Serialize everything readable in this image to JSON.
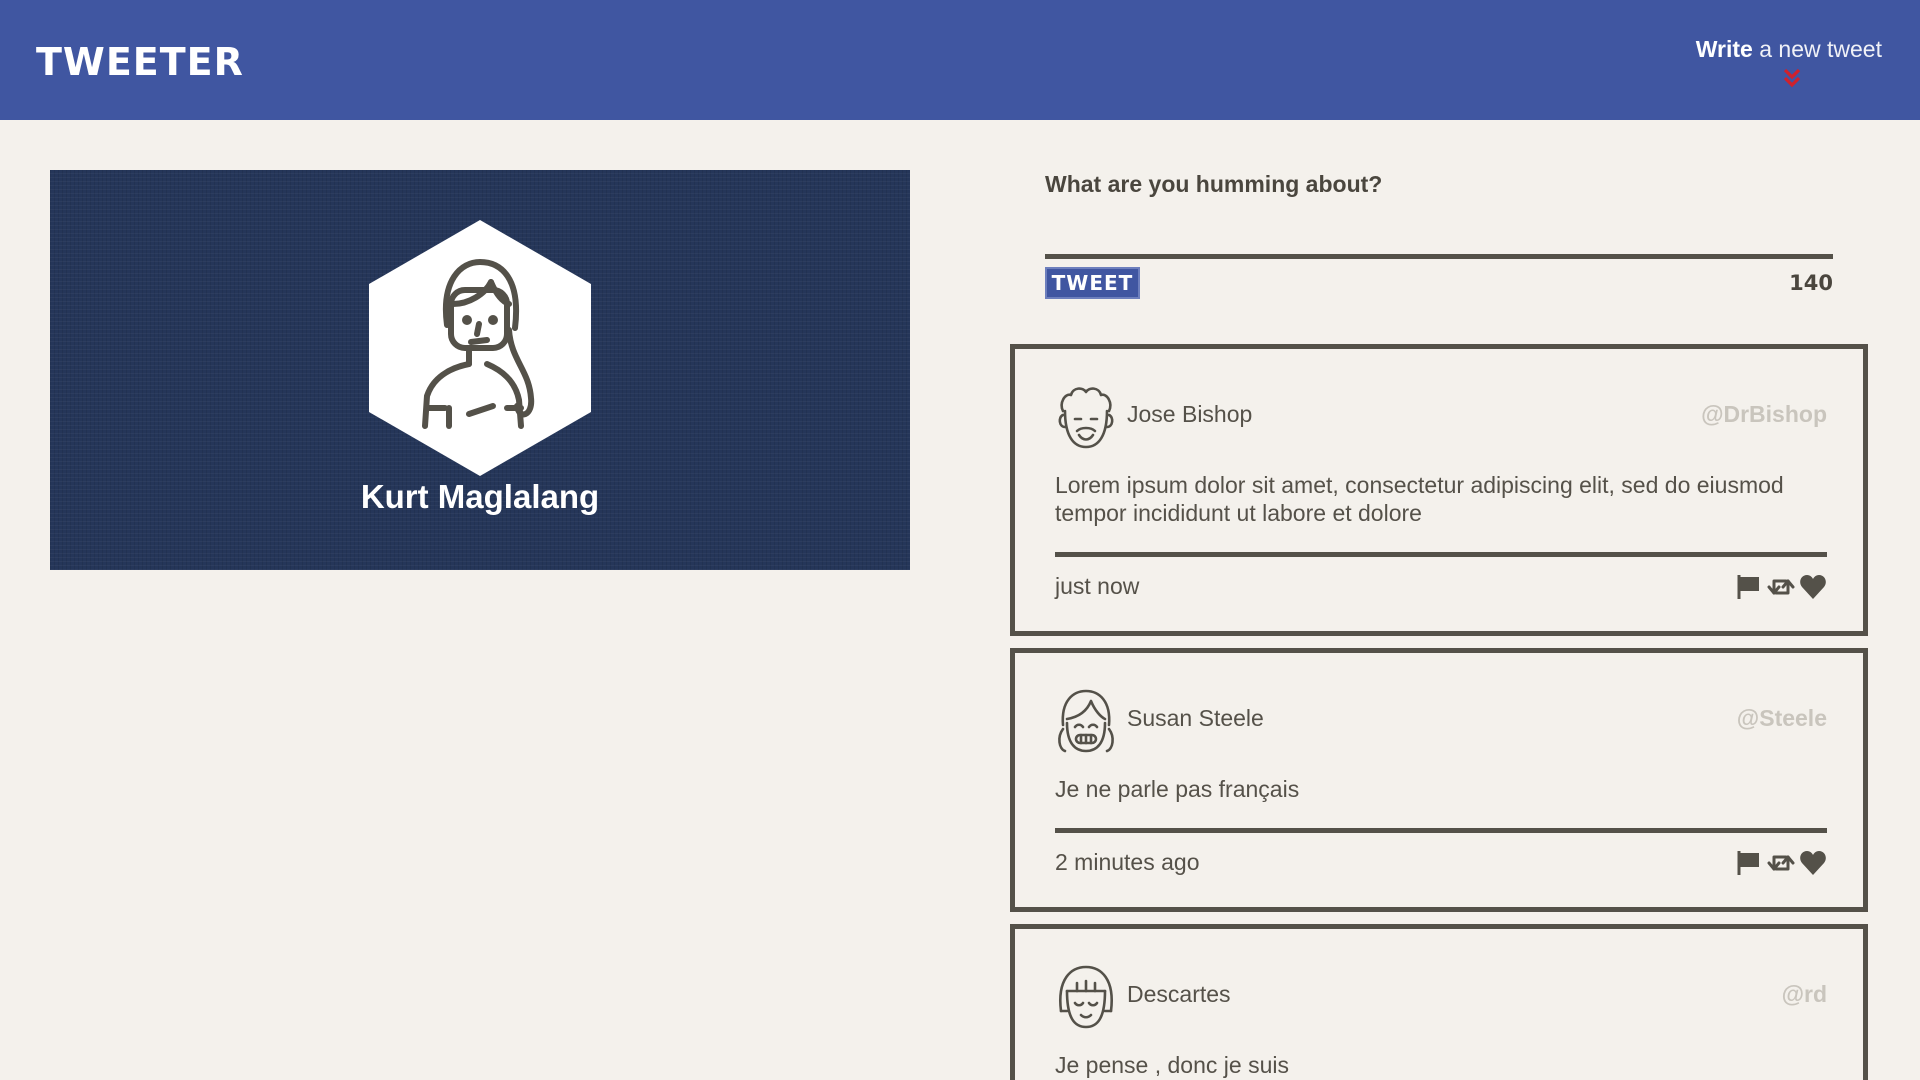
{
  "header": {
    "brand": "TWEETER",
    "compose_toggle": {
      "strong": "Write",
      "rest": " a new tweet"
    },
    "icon": "double-chevron-down-icon"
  },
  "profile": {
    "name": "Kurt Maglalang",
    "avatar_icon": "woman-avatar-icon"
  },
  "compose": {
    "prompt": "What are you humming about?",
    "input_value": "",
    "button_label": "TWEET",
    "char_count": "140"
  },
  "tweets": [
    {
      "name": "Jose Bishop",
      "handle": "@DrBishop",
      "text": "Lorem ipsum dolor sit amet, consectetur adipiscing elit, sed do eiusmod tempor incididunt ut labore et dolore",
      "time": "just now",
      "avatar_icon": "curly-hair-man-avatar-icon"
    },
    {
      "name": "Susan Steele",
      "handle": "@Steele",
      "text": "Je ne parle pas français",
      "time": "2 minutes ago",
      "avatar_icon": "pigtails-girl-avatar-icon"
    },
    {
      "name": "Descartes",
      "handle": "@rd",
      "text": "Je pense , donc je suis",
      "time": "",
      "avatar_icon": "bob-hair-avatar-icon"
    }
  ],
  "colors": {
    "header": "#4056a1",
    "accent_red": "#d0212b",
    "profile_bg": "#253659",
    "page_bg": "#f4f1ec",
    "ink": "#545149",
    "handle": "#c9c5bd"
  }
}
